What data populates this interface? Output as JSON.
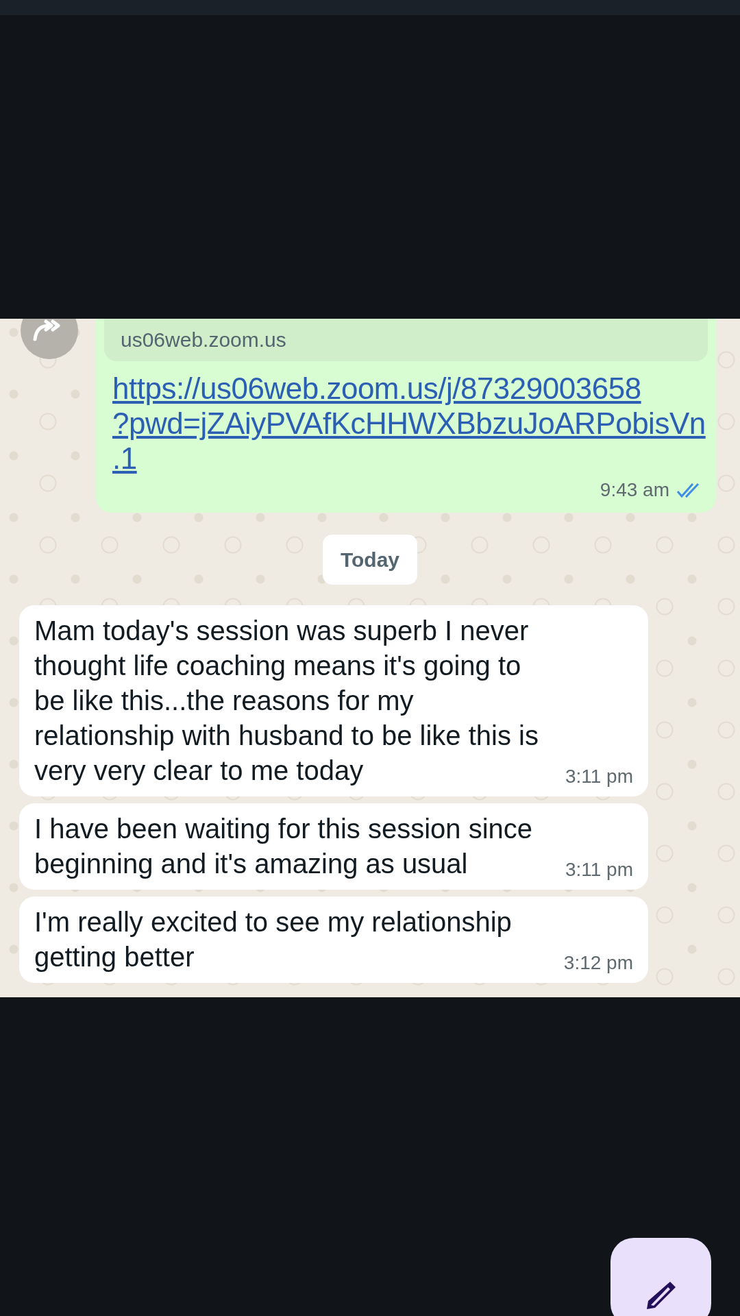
{
  "link_preview": {
    "domain": "us06web.zoom.us"
  },
  "outgoing": {
    "link_lines": [
      "https://us06web.zoom.us/j/87329003658",
      "?pwd=jZAiyPVAfKcHHWXBbzuJoARPobisVn",
      ".1"
    ],
    "time": "9:43 am",
    "read": true
  },
  "date_divider": "Today",
  "messages": [
    {
      "text": "Mam today's session was superb I never thought life coaching means it's going to be like this...the reasons for my relationship with husband to be like this is very very clear to me today",
      "time": "3:11 pm"
    },
    {
      "text": "I have been waiting for this session since beginning and it's amazing as usual",
      "time": "3:11 pm"
    },
    {
      "text": "I'm really excited to see my relationship getting better",
      "time": "3:12 pm"
    }
  ]
}
